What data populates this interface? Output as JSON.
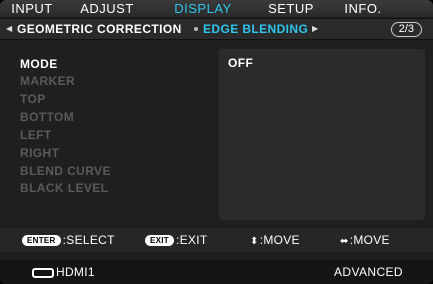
{
  "menu": {
    "tabs": [
      {
        "label": "INPUT",
        "active": false
      },
      {
        "label": "ADJUST",
        "active": false
      },
      {
        "label": "DISPLAY",
        "active": true
      },
      {
        "label": "SETUP",
        "active": false
      },
      {
        "label": "INFO.",
        "active": false
      }
    ],
    "subtabs": [
      {
        "label": "GEOMETRIC CORRECTION",
        "active": false
      },
      {
        "label": "EDGE BLENDING",
        "active": true
      }
    ],
    "page_indicator": "2/3"
  },
  "settings": {
    "items": [
      {
        "label": "MODE",
        "enabled": true
      },
      {
        "label": "MARKER",
        "enabled": false
      },
      {
        "label": "TOP",
        "enabled": false
      },
      {
        "label": "BOTTOM",
        "enabled": false
      },
      {
        "label": "LEFT",
        "enabled": false
      },
      {
        "label": "RIGHT",
        "enabled": false
      },
      {
        "label": "BLEND CURVE",
        "enabled": false
      },
      {
        "label": "BLACK LEVEL",
        "enabled": false
      }
    ],
    "selected_value": "OFF"
  },
  "help": {
    "enter_key": "ENTER",
    "enter_label": ":SELECT",
    "exit_key": "EXIT",
    "exit_label": ":EXIT",
    "updown_label": ":MOVE",
    "leftright_label": ":MOVE"
  },
  "status": {
    "input_icon": "hdmi-connector-icon",
    "input_label": "HDMI1",
    "mode_label": "ADVANCED"
  },
  "colors": {
    "accent": "#2fc5ee",
    "disabled_text": "#5a5a5a",
    "text": "#ffffff"
  }
}
